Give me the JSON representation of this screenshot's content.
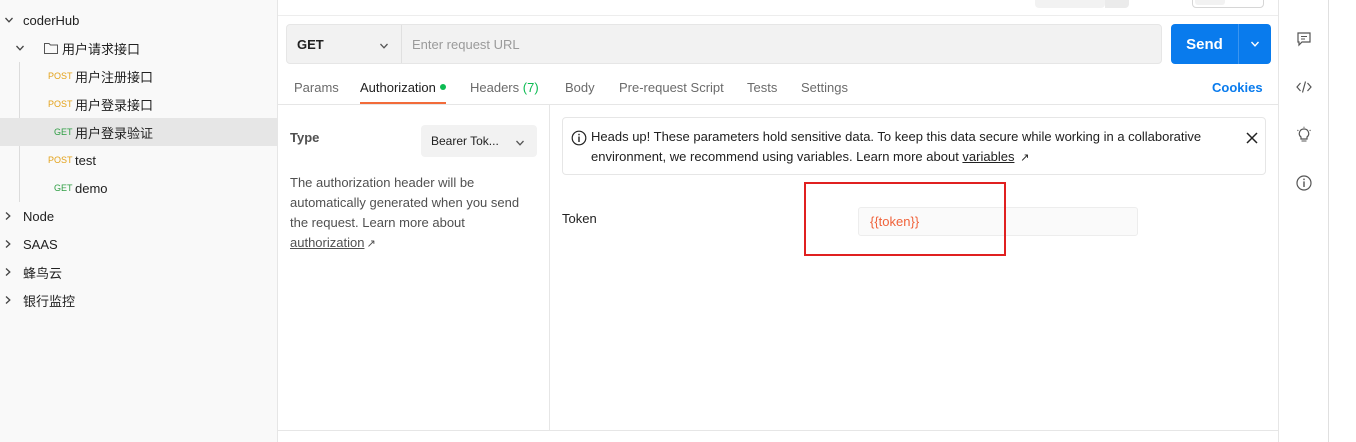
{
  "sidebar": {
    "rows": [
      {
        "kind": "collection",
        "label": "coderHub",
        "expanded": true
      },
      {
        "kind": "folder",
        "label": "用户请求接口",
        "expanded": true
      },
      {
        "kind": "request",
        "method": "POST",
        "label": "用户注册接口"
      },
      {
        "kind": "request",
        "method": "POST",
        "label": "用户登录接口"
      },
      {
        "kind": "request",
        "method": "GET",
        "label": "用户登录验证",
        "selected": true
      },
      {
        "kind": "request",
        "method": "POST",
        "label": "test"
      },
      {
        "kind": "request",
        "method": "GET",
        "label": "demo"
      },
      {
        "kind": "collection",
        "label": "Node",
        "expanded": false
      },
      {
        "kind": "collection",
        "label": "SAAS",
        "expanded": false
      },
      {
        "kind": "collection",
        "label": "蜂鸟云",
        "expanded": false
      },
      {
        "kind": "collection",
        "label": "银行监控",
        "expanded": false
      }
    ]
  },
  "request": {
    "method": "GET",
    "url_placeholder": "Enter request URL",
    "url_value": "",
    "send_label": "Send"
  },
  "tabs": {
    "params": "Params",
    "authorization": "Authorization",
    "headers": "Headers",
    "headers_count": "(7)",
    "body": "Body",
    "prerequest": "Pre-request Script",
    "tests": "Tests",
    "settings": "Settings",
    "cookies": "Cookies"
  },
  "auth": {
    "type_label": "Type",
    "type_value": "Bearer Tok...",
    "description": "The authorization header will be automatically generated when you send the request. Learn more about ",
    "description_link": "authorization",
    "notice_text": "Heads up! These parameters hold sensitive data. To keep this data secure while working in a collaborative environment, we recommend using variables. Learn more about ",
    "notice_link": "variables",
    "token_label": "Token",
    "token_value": "{{token}}"
  },
  "colors": {
    "accent": "#097bed",
    "tab_underline": "#f26b3a",
    "post": "#e3a21a",
    "get": "#2f9e44",
    "token_text": "#f0623a",
    "highlight_box": "#e02020"
  },
  "rail_icons": [
    "comment-icon",
    "code-icon",
    "lightbulb-icon",
    "info-icon"
  ]
}
